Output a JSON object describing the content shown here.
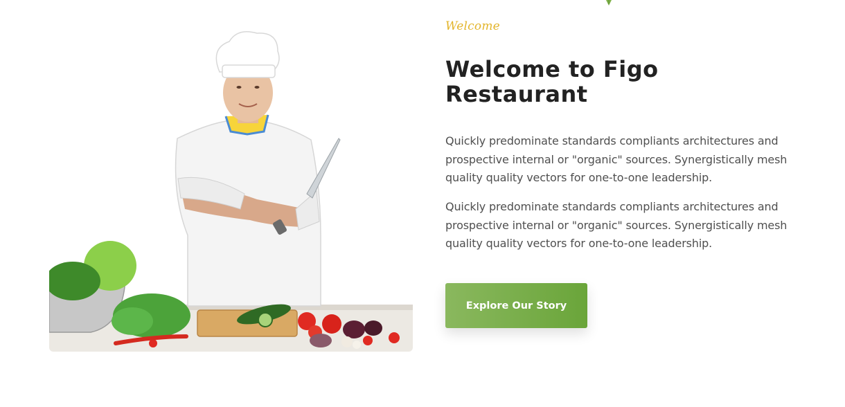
{
  "section": {
    "eyebrow": "Welcome",
    "title_line1": "Welcome to Figo",
    "title_line2": "Restaurant",
    "paragraphs": [
      "Quickly predominate standards compliants architectures and prospective internal or \"organic\" sources. Synergistically mesh quality quality vectors for one-to-one leadership.",
      "Quickly predominate standards compliants architectures and prospective internal or \"organic\" sources. Synergistically mesh quality quality vectors for one-to-one leadership."
    ],
    "cta_label": "Explore Our Story"
  },
  "image": {
    "icon": "chef-with-vegetables-photo"
  },
  "decoration": {
    "icon": "leaf-icon"
  },
  "colors": {
    "accent_yellow": "#e3b52c",
    "accent_green": "#6aa53a",
    "heading": "#222222",
    "body_text": "#4f4f4f"
  }
}
